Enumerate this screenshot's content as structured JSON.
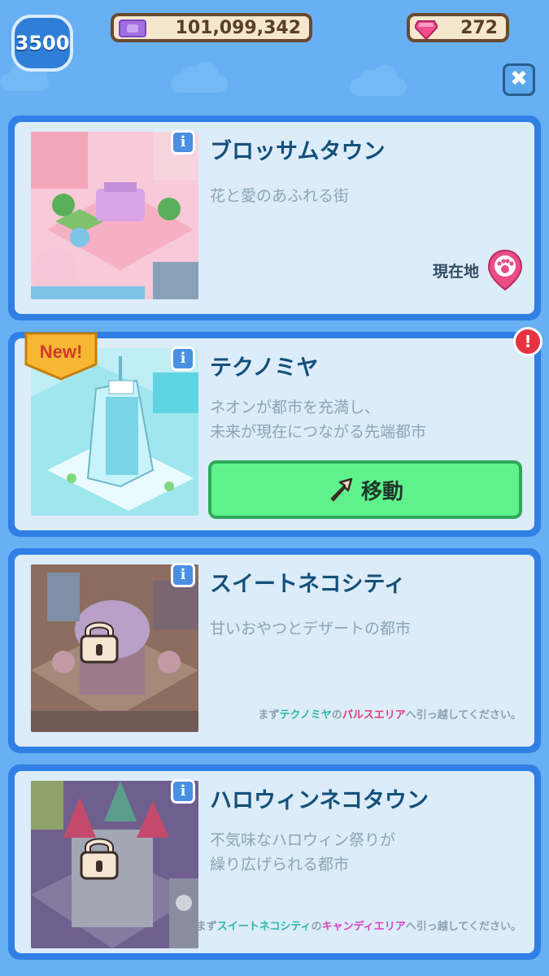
{
  "header": {
    "level": "3500",
    "coins": "101,099,342",
    "gems": "272",
    "close_label": "✖"
  },
  "cards": [
    {
      "title": "ブロッサムタウン",
      "description": [
        "花と愛のあふれる街"
      ],
      "location_label": "現在地"
    },
    {
      "title": "テクノミヤ",
      "description": [
        "ネオンが都市を充満し、",
        "未来が現在につながる先端都市"
      ],
      "badge": "New!",
      "alert": "!",
      "move_label": "移動"
    },
    {
      "title": "スイートネコシティ",
      "description": [
        "甘いおやつとデザートの都市"
      ],
      "hint": {
        "pre": "まず",
        "city": "テクノミヤ",
        "mid": "の",
        "area": "パルスエリア",
        "post": "へ引っ越してください。"
      }
    },
    {
      "title": "ハロウィンネコタウン",
      "description": [
        "不気味なハロウィン祭りが",
        "繰り広げられる都市"
      ],
      "hint": {
        "pre": "まず",
        "city": "スイートネコシティ",
        "mid": "の",
        "area": "キャンディエリア",
        "post": "へ引っ越してください。"
      }
    }
  ],
  "colors": {
    "background": "#66b0f3",
    "card_border": "#2f7fe4",
    "card_fill": "#dcecf9",
    "title": "#14507a",
    "move_button": "#5ff28c",
    "alert": "#e53342"
  },
  "icons": [
    "level-badge",
    "cash-icon",
    "gem-icon",
    "close-icon",
    "info-icon",
    "location-pin-icon",
    "arrow-icon",
    "lock-icon",
    "new-badge",
    "alert-icon"
  ]
}
